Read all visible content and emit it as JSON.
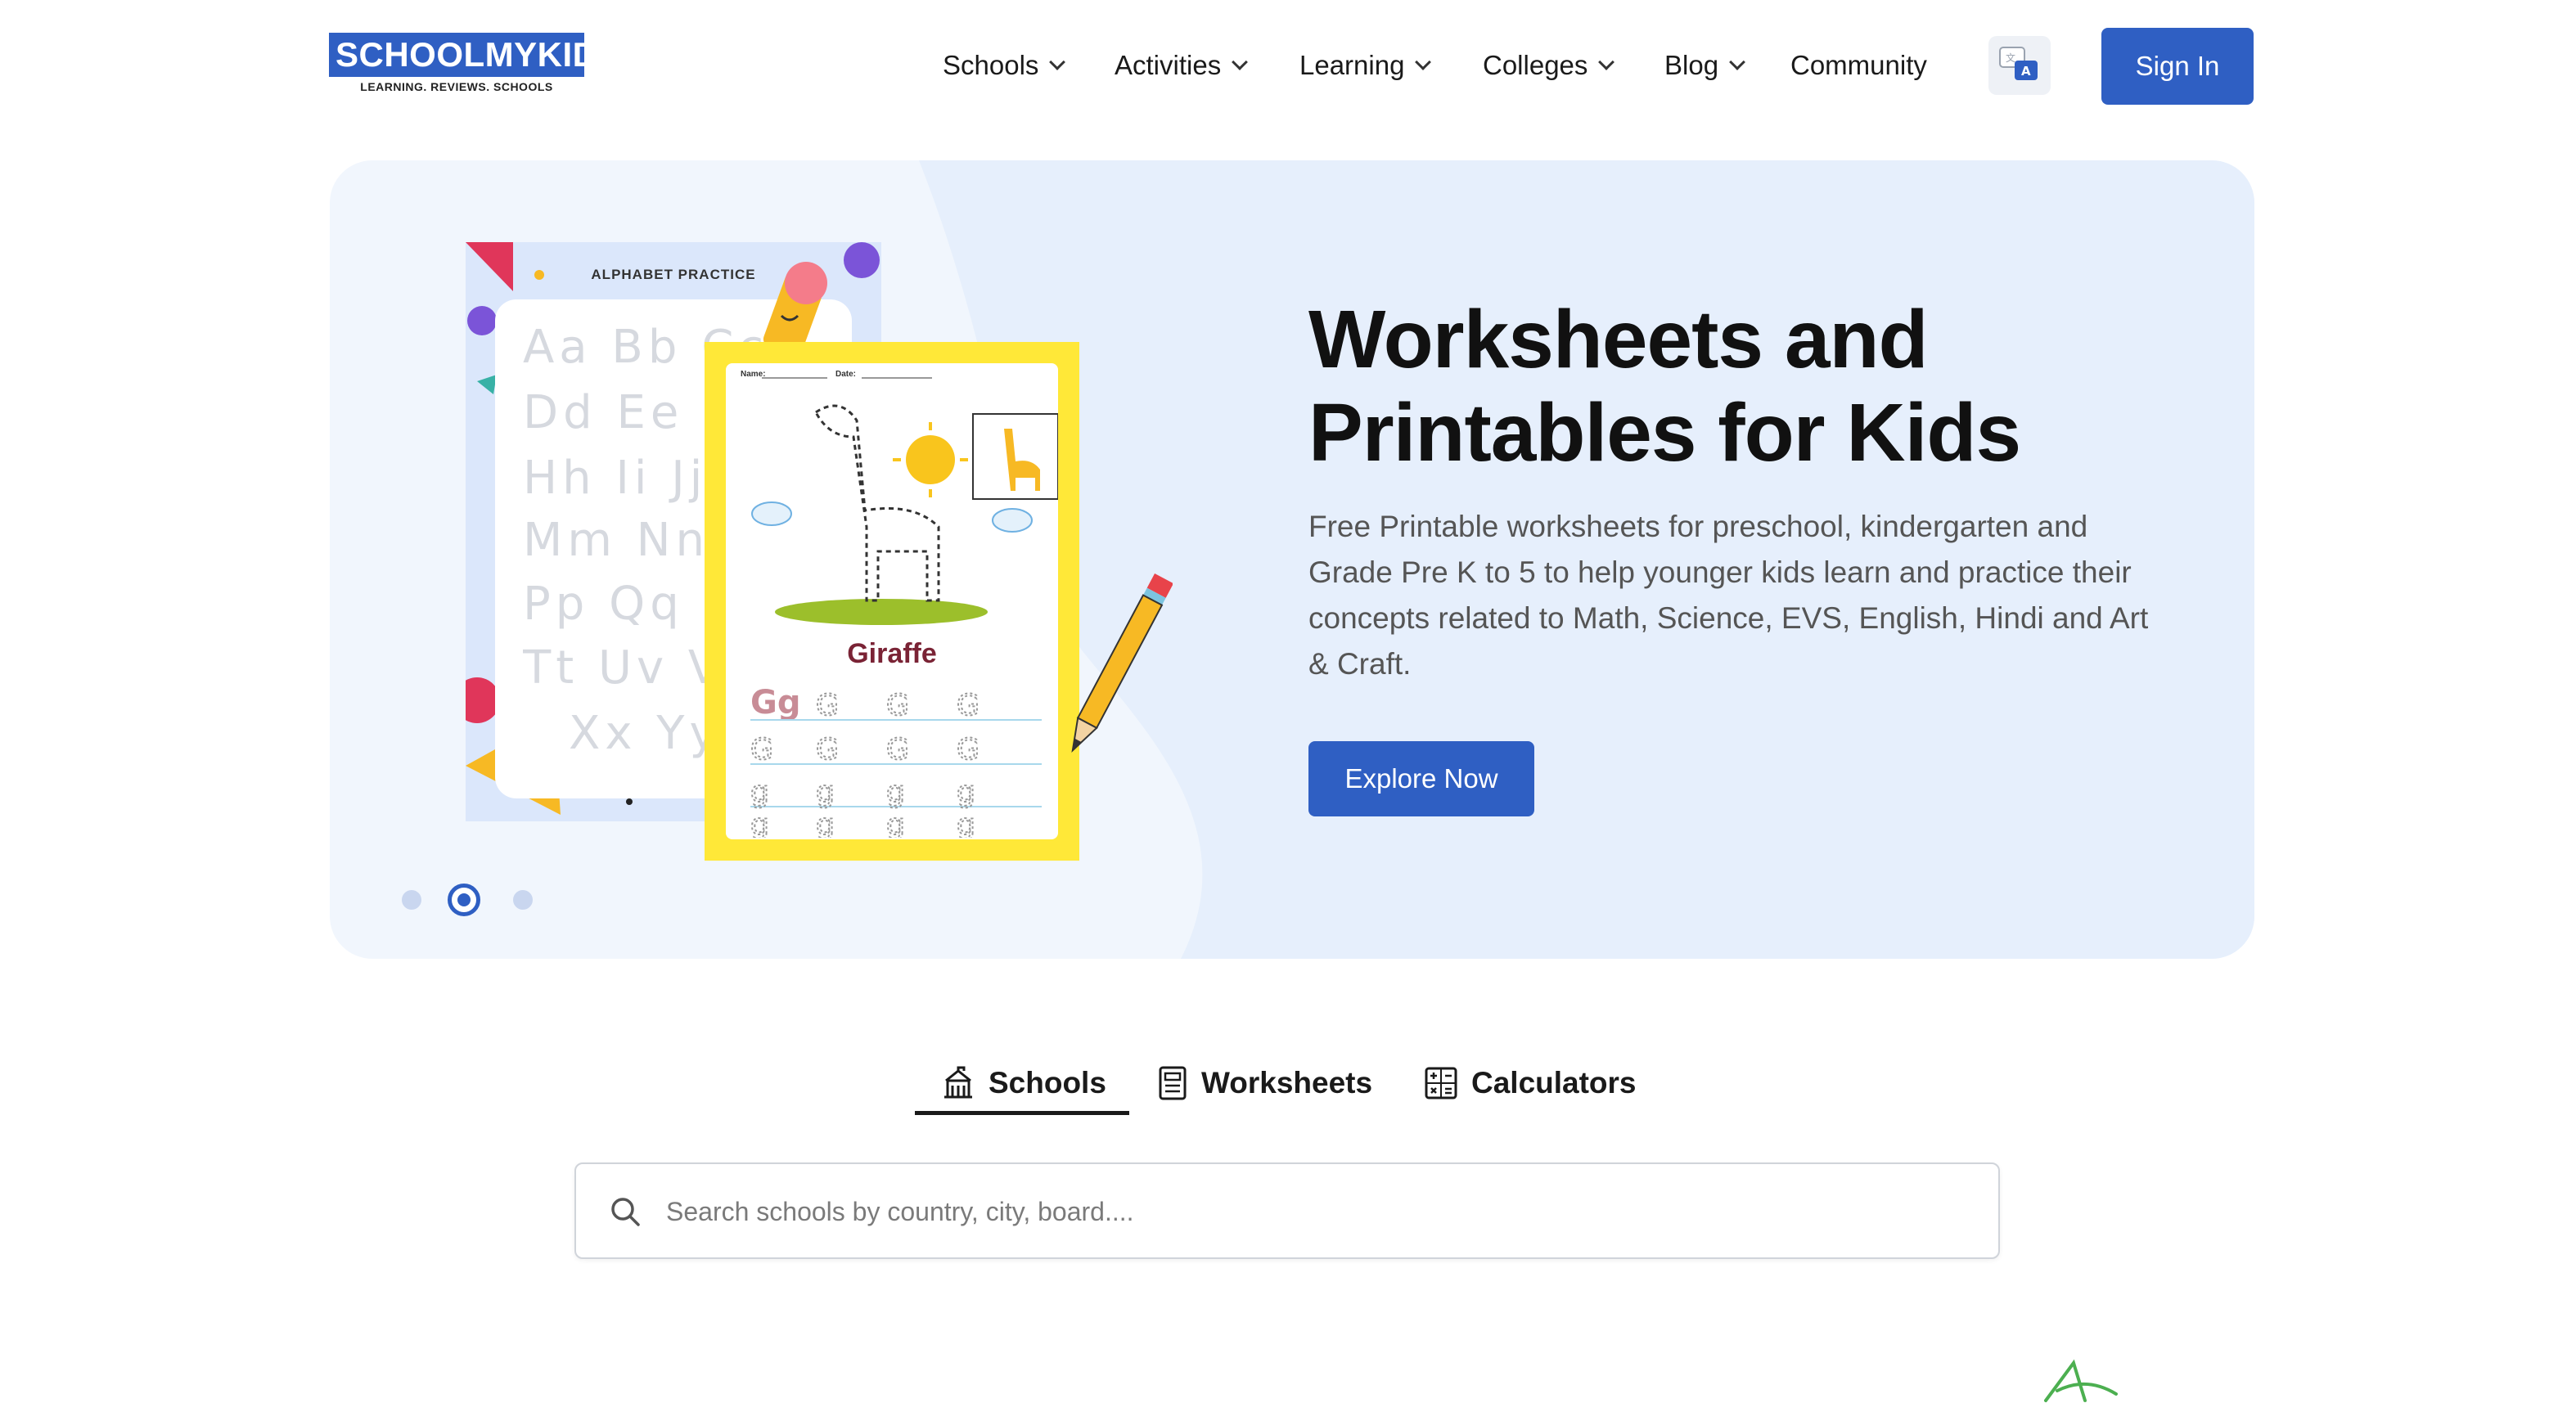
{
  "header": {
    "logo_text": "SCHOOLMYKIDS",
    "logo_tagline": "LEARNING. REVIEWS. SCHOOLS",
    "nav": [
      {
        "label": "Schools",
        "has_dropdown": true
      },
      {
        "label": "Activities",
        "has_dropdown": true
      },
      {
        "label": "Learning",
        "has_dropdown": true
      },
      {
        "label": "Colleges",
        "has_dropdown": true
      },
      {
        "label": "Blog",
        "has_dropdown": true
      },
      {
        "label": "Community",
        "has_dropdown": false
      }
    ],
    "translate_icon": "translate-icon",
    "sign_in_label": "Sign In"
  },
  "hero": {
    "title_line1": "Worksheets and",
    "title_line2": "Printables for Kids",
    "description": "Free Printable worksheets for preschool, kindergarten and Grade Pre K to 5 to help younger kids learn and practice their concepts related to Math, Science, EVS, English, Hindi and Art & Craft.",
    "cta_label": "Explore Now",
    "sheet_back_title": "ALPHABET PRACTICE",
    "trace_rows": [
      "Aa Bb Cc",
      "Dd Ee Ff",
      "Hh Ii Jj",
      "Mm Nn",
      "Pp Qq R",
      "Tt Uv V",
      "Xx Yy"
    ],
    "sheet_front_name_label": "Name:",
    "sheet_front_date_label": "Date:",
    "sheet_front_word": "Giraffe",
    "sheet_front_letter": "Gg",
    "slider": {
      "count": 3,
      "active_index": 1
    }
  },
  "tabs": [
    {
      "label": "Schools",
      "icon": "school-building-icon",
      "active": true
    },
    {
      "label": "Worksheets",
      "icon": "worksheet-icon",
      "active": false
    },
    {
      "label": "Calculators",
      "icon": "calculator-icon",
      "active": false
    }
  ],
  "search": {
    "placeholder": "Search schools by country, city, board....",
    "value": ""
  },
  "colors": {
    "primary": "#2f5fc3",
    "hero_bg": "#f1f6fd",
    "text_dark": "#111111",
    "text_muted": "#555555"
  }
}
